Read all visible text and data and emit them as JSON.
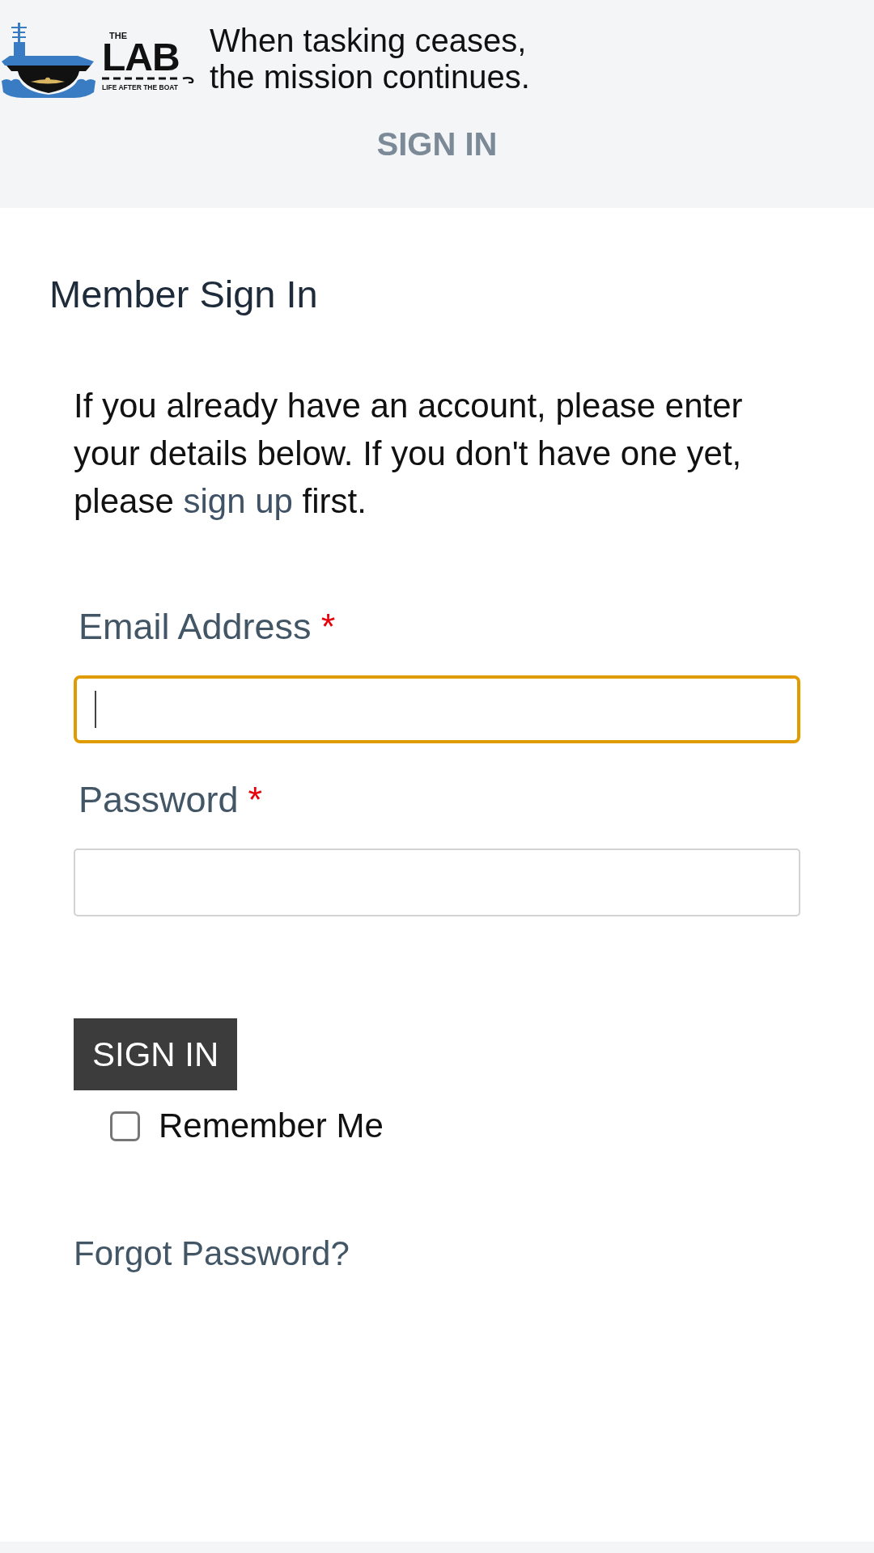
{
  "header": {
    "logo": {
      "top_word": "THE",
      "word": "LAB",
      "subtitle": "LIFE AFTER THE BOAT"
    },
    "tagline": "When tasking ceases, the mission continues.",
    "nav_link": "SIGN IN"
  },
  "page": {
    "title": "Member Sign In",
    "intro": {
      "before": "If you already have an account, please enter your details below. If you don't have one yet, please ",
      "link": "sign up",
      "after": " first."
    }
  },
  "form": {
    "fields": [
      {
        "label": "Email Address",
        "required_mark": "*",
        "focused": true
      },
      {
        "label": "Password",
        "required_mark": "*",
        "focused": false
      }
    ],
    "submit": "SIGN IN",
    "remember": {
      "label": "Remember Me",
      "checked": false
    },
    "forgot_link": "Forgot Password?"
  }
}
